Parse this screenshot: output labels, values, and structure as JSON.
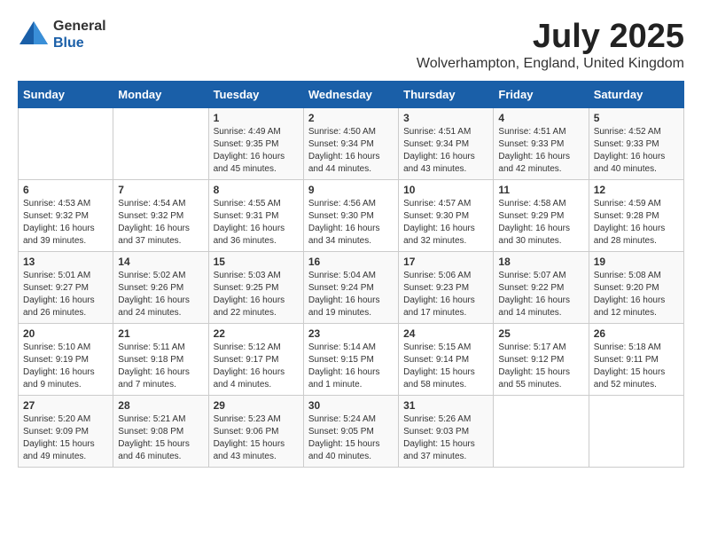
{
  "header": {
    "logo_general": "General",
    "logo_blue": "Blue",
    "title": "July 2025",
    "subtitle": "Wolverhampton, England, United Kingdom"
  },
  "weekdays": [
    "Sunday",
    "Monday",
    "Tuesday",
    "Wednesday",
    "Thursday",
    "Friday",
    "Saturday"
  ],
  "weeks": [
    [
      {
        "day": "",
        "info": ""
      },
      {
        "day": "",
        "info": ""
      },
      {
        "day": "1",
        "info": "Sunrise: 4:49 AM\nSunset: 9:35 PM\nDaylight: 16 hours and 45 minutes."
      },
      {
        "day": "2",
        "info": "Sunrise: 4:50 AM\nSunset: 9:34 PM\nDaylight: 16 hours and 44 minutes."
      },
      {
        "day": "3",
        "info": "Sunrise: 4:51 AM\nSunset: 9:34 PM\nDaylight: 16 hours and 43 minutes."
      },
      {
        "day": "4",
        "info": "Sunrise: 4:51 AM\nSunset: 9:33 PM\nDaylight: 16 hours and 42 minutes."
      },
      {
        "day": "5",
        "info": "Sunrise: 4:52 AM\nSunset: 9:33 PM\nDaylight: 16 hours and 40 minutes."
      }
    ],
    [
      {
        "day": "6",
        "info": "Sunrise: 4:53 AM\nSunset: 9:32 PM\nDaylight: 16 hours and 39 minutes."
      },
      {
        "day": "7",
        "info": "Sunrise: 4:54 AM\nSunset: 9:32 PM\nDaylight: 16 hours and 37 minutes."
      },
      {
        "day": "8",
        "info": "Sunrise: 4:55 AM\nSunset: 9:31 PM\nDaylight: 16 hours and 36 minutes."
      },
      {
        "day": "9",
        "info": "Sunrise: 4:56 AM\nSunset: 9:30 PM\nDaylight: 16 hours and 34 minutes."
      },
      {
        "day": "10",
        "info": "Sunrise: 4:57 AM\nSunset: 9:30 PM\nDaylight: 16 hours and 32 minutes."
      },
      {
        "day": "11",
        "info": "Sunrise: 4:58 AM\nSunset: 9:29 PM\nDaylight: 16 hours and 30 minutes."
      },
      {
        "day": "12",
        "info": "Sunrise: 4:59 AM\nSunset: 9:28 PM\nDaylight: 16 hours and 28 minutes."
      }
    ],
    [
      {
        "day": "13",
        "info": "Sunrise: 5:01 AM\nSunset: 9:27 PM\nDaylight: 16 hours and 26 minutes."
      },
      {
        "day": "14",
        "info": "Sunrise: 5:02 AM\nSunset: 9:26 PM\nDaylight: 16 hours and 24 minutes."
      },
      {
        "day": "15",
        "info": "Sunrise: 5:03 AM\nSunset: 9:25 PM\nDaylight: 16 hours and 22 minutes."
      },
      {
        "day": "16",
        "info": "Sunrise: 5:04 AM\nSunset: 9:24 PM\nDaylight: 16 hours and 19 minutes."
      },
      {
        "day": "17",
        "info": "Sunrise: 5:06 AM\nSunset: 9:23 PM\nDaylight: 16 hours and 17 minutes."
      },
      {
        "day": "18",
        "info": "Sunrise: 5:07 AM\nSunset: 9:22 PM\nDaylight: 16 hours and 14 minutes."
      },
      {
        "day": "19",
        "info": "Sunrise: 5:08 AM\nSunset: 9:20 PM\nDaylight: 16 hours and 12 minutes."
      }
    ],
    [
      {
        "day": "20",
        "info": "Sunrise: 5:10 AM\nSunset: 9:19 PM\nDaylight: 16 hours and 9 minutes."
      },
      {
        "day": "21",
        "info": "Sunrise: 5:11 AM\nSunset: 9:18 PM\nDaylight: 16 hours and 7 minutes."
      },
      {
        "day": "22",
        "info": "Sunrise: 5:12 AM\nSunset: 9:17 PM\nDaylight: 16 hours and 4 minutes."
      },
      {
        "day": "23",
        "info": "Sunrise: 5:14 AM\nSunset: 9:15 PM\nDaylight: 16 hours and 1 minute."
      },
      {
        "day": "24",
        "info": "Sunrise: 5:15 AM\nSunset: 9:14 PM\nDaylight: 15 hours and 58 minutes."
      },
      {
        "day": "25",
        "info": "Sunrise: 5:17 AM\nSunset: 9:12 PM\nDaylight: 15 hours and 55 minutes."
      },
      {
        "day": "26",
        "info": "Sunrise: 5:18 AM\nSunset: 9:11 PM\nDaylight: 15 hours and 52 minutes."
      }
    ],
    [
      {
        "day": "27",
        "info": "Sunrise: 5:20 AM\nSunset: 9:09 PM\nDaylight: 15 hours and 49 minutes."
      },
      {
        "day": "28",
        "info": "Sunrise: 5:21 AM\nSunset: 9:08 PM\nDaylight: 15 hours and 46 minutes."
      },
      {
        "day": "29",
        "info": "Sunrise: 5:23 AM\nSunset: 9:06 PM\nDaylight: 15 hours and 43 minutes."
      },
      {
        "day": "30",
        "info": "Sunrise: 5:24 AM\nSunset: 9:05 PM\nDaylight: 15 hours and 40 minutes."
      },
      {
        "day": "31",
        "info": "Sunrise: 5:26 AM\nSunset: 9:03 PM\nDaylight: 15 hours and 37 minutes."
      },
      {
        "day": "",
        "info": ""
      },
      {
        "day": "",
        "info": ""
      }
    ]
  ]
}
